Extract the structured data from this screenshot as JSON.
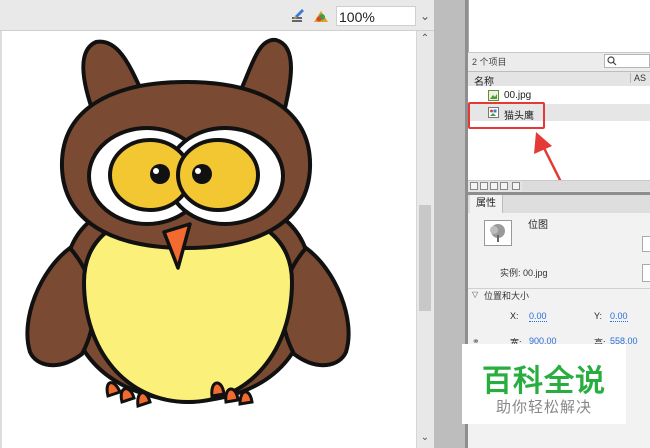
{
  "stage": {
    "zoom_value": "100%"
  },
  "library": {
    "item_count": "2 个项目",
    "col_name": "名称",
    "col_as": "AS",
    "items": [
      {
        "label": "00.jpg"
      },
      {
        "label": "猫头鹰"
      }
    ]
  },
  "properties": {
    "tab_label": "属性",
    "type_label": "位图",
    "instance_label": "实例: 00.jpg",
    "section_label": "位置和大小",
    "x_label": "X:",
    "x_value": "0.00",
    "y_label": "Y:",
    "y_value": "0.00",
    "w_label": "宽:",
    "w_value": "900.00",
    "h_label": "高:",
    "h_value": "558.00"
  },
  "watermark": {
    "title": "百科全说",
    "subtitle": "助你轻松解决"
  },
  "colors": {
    "owl_brown": "#7a4a32",
    "owl_yellow_eye": "#f2c732",
    "owl_belly": "#fbf07a",
    "owl_beak": "#f26a2e",
    "highlight_red": "#e53935",
    "watermark_green": "#27ae3f"
  }
}
